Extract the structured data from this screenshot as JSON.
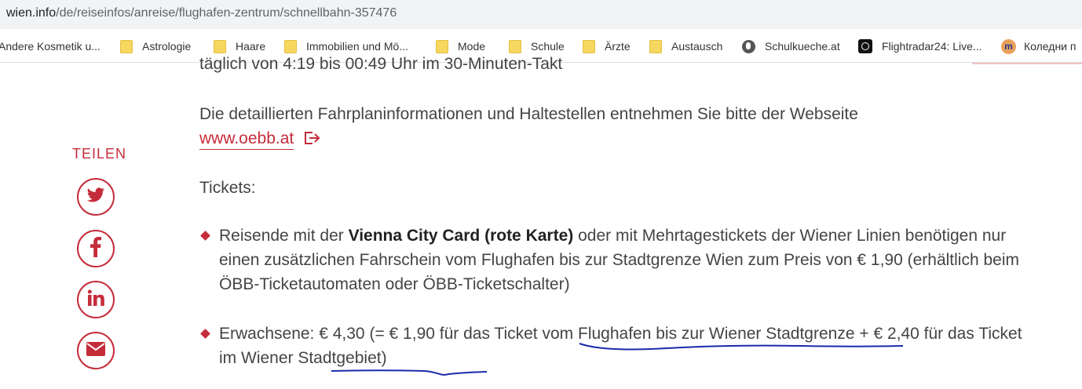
{
  "browser": {
    "url_domain": "wien.info",
    "url_path": "/de/reiseinfos/anreise/flughafen-zentrum/schnellbahn-357476",
    "bookmarks": [
      {
        "label": "Andere Kosmetik u...",
        "icon": "folder-icon"
      },
      {
        "label": "Astrologie",
        "icon": "folder-icon"
      },
      {
        "label": "Haare",
        "icon": "folder-icon"
      },
      {
        "label": "Immobilien und Mö...",
        "icon": "folder-icon"
      },
      {
        "label": "Mode",
        "icon": "folder-icon"
      },
      {
        "label": "Schule",
        "icon": "folder-icon"
      },
      {
        "label": "Ärzte",
        "icon": "folder-icon"
      },
      {
        "label": "Austausch",
        "icon": "folder-icon"
      },
      {
        "label": "Schulkueche.at",
        "icon": "globe-icon"
      },
      {
        "label": "Flightradar24: Live...",
        "icon": "flightradar-icon"
      },
      {
        "label": "Коледни п",
        "icon": "m-logo-icon"
      }
    ]
  },
  "share": {
    "label": "TEILEN",
    "buttons": [
      "twitter-icon",
      "facebook-icon",
      "linkedin-icon",
      "email-icon"
    ]
  },
  "content": {
    "partial_line": "täglich von 4:19 bis 00:49 Uhr im 30-Minuten-Takt",
    "fahrplan_text": "Die detaillierten Fahrplaninformationen und Haltestellen entnehmen Sie bitte der Webseite",
    "oebb_link": "www.oebb.at",
    "tickets_heading": "Tickets:",
    "item1": {
      "pre": "Reisende mit der ",
      "bold": "Vienna City Card (rote Karte)",
      "post": " oder mit Mehrtagestickets der Wiener Linien benötigen nur einen zusätzlichen Fahrschein vom Flughafen bis zur Stadtgrenze Wien zum Preis von € 1,90 (erhältlich beim ÖBB-Ticketautomaten oder ÖBB-Ticketschalter)"
    },
    "item2": {
      "text": "Erwachsene: € 4,30 (= € 1,90 für das Ticket vom Flughafen bis zur Wiener Stadtgrenze + € 2,40 für das Ticket im Wiener Stadtgebiet)"
    }
  },
  "colors": {
    "accent": "#c52c3a",
    "text": "#444444",
    "ink": "#1a2aa8"
  }
}
